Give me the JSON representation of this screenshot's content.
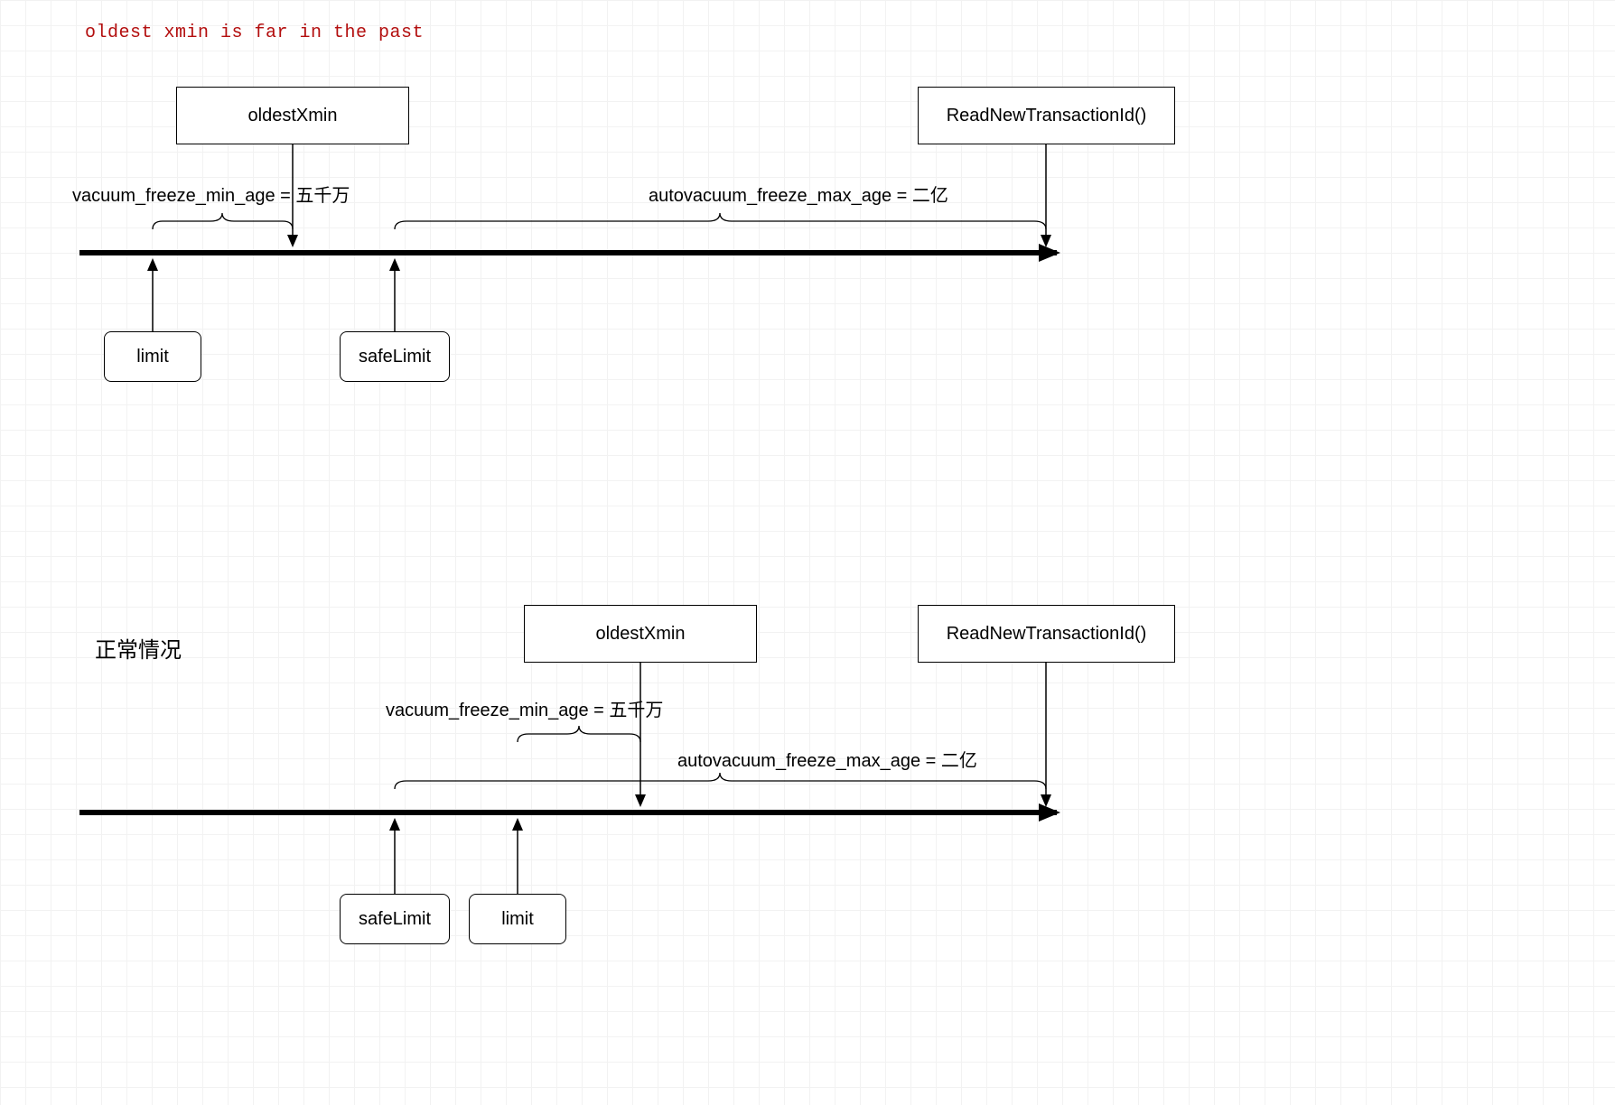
{
  "diagram1": {
    "title": "oldest xmin is far in the past",
    "oldestXmin": "oldestXmin",
    "readNew": "ReadNewTransactionId()",
    "limit": "limit",
    "safeLimit": "safeLimit",
    "vacuumLabel": "vacuum_freeze_min_age = 五千万",
    "autovacuumLabel": "autovacuum_freeze_max_age = 二亿"
  },
  "diagram2": {
    "title": "正常情况",
    "oldestXmin": "oldestXmin",
    "readNew": "ReadNewTransactionId()",
    "limit": "limit",
    "safeLimit": "safeLimit",
    "vacuumLabel": "vacuum_freeze_min_age = 五千万",
    "autovacuumLabel": "autovacuum_freeze_max_age = 二亿"
  }
}
